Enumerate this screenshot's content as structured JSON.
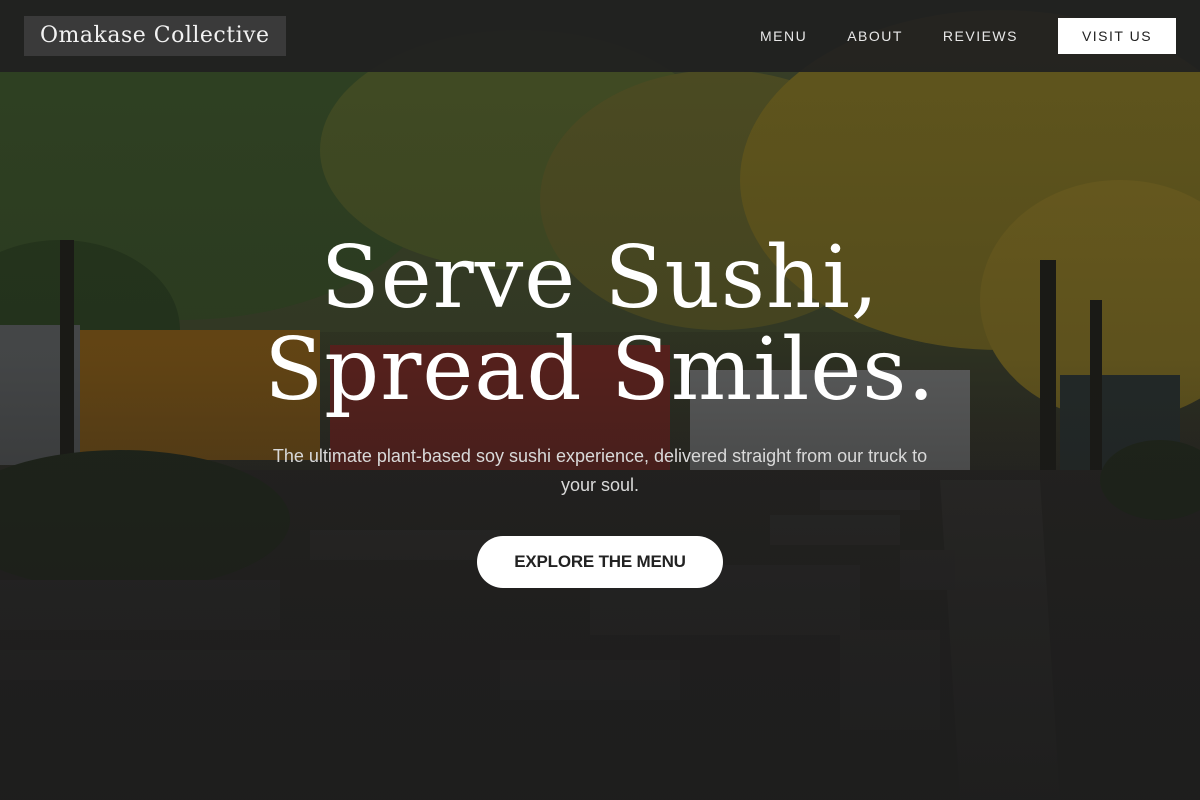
{
  "nav": {
    "brand": "Omakase Collective",
    "links": [
      "MENU",
      "ABOUT",
      "REVIEWS"
    ],
    "cta": "VISIT US"
  },
  "hero": {
    "title_line1": "Serve Sushi,",
    "title_line2": "Spread Smiles.",
    "subtitle": "The ultimate plant-based soy sushi experience, delivered straight from our truck to your soul.",
    "cta": "EXPLORE THE MENU"
  },
  "colors": {
    "navbar_bg": "#202020",
    "brand_bg": "#3a3a3a",
    "button_bg": "#ffffff",
    "text_light": "#ffffff"
  }
}
